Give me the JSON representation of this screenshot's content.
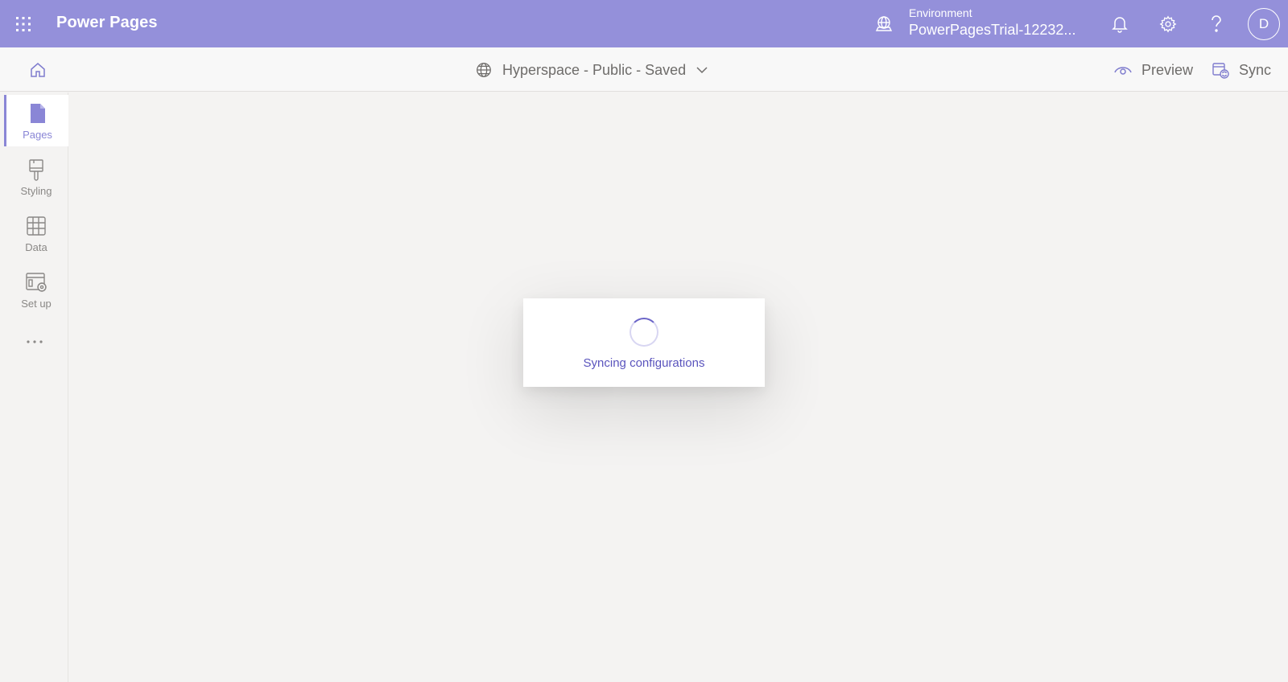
{
  "header": {
    "app_title": "Power Pages",
    "environment_label": "Environment",
    "environment_name": "PowerPagesTrial-12232...",
    "avatar_initial": "D"
  },
  "commandbar": {
    "site_name": "Hyperspace - Public - Saved",
    "preview_label": "Preview",
    "sync_label": "Sync"
  },
  "sidebar": {
    "items": [
      {
        "label": "Pages",
        "icon": "page-icon",
        "active": true
      },
      {
        "label": "Styling",
        "icon": "paintbrush-icon",
        "active": false
      },
      {
        "label": "Data",
        "icon": "table-icon",
        "active": false
      },
      {
        "label": "Set up",
        "icon": "setup-gear-icon",
        "active": false
      }
    ],
    "more_icon": "more-horizontal-icon"
  },
  "dialog": {
    "message": "Syncing configurations"
  },
  "colors": {
    "header_bg": "#9490da",
    "accent": "#8a86d6",
    "dialog_text": "#5a54bd"
  }
}
